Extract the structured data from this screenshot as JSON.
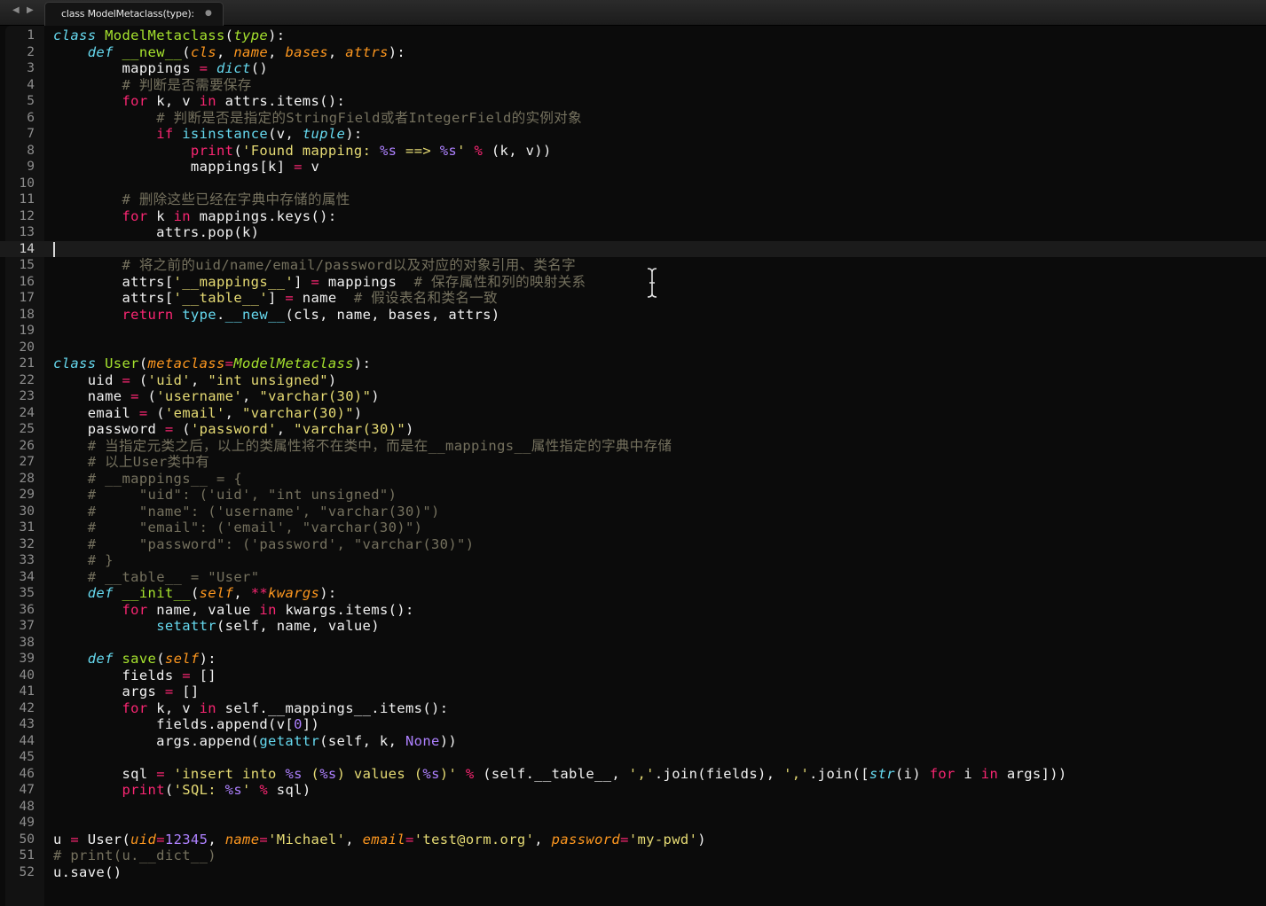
{
  "window": {
    "tab_title": "class ModelMetaclass(type):",
    "tab_modified_marker": "●",
    "nav_back": "◀",
    "nav_forward": "▶"
  },
  "colors": {
    "keyword": "#f92672",
    "storage": "#66d9ef",
    "class_name": "#a6e22e",
    "parameter": "#fd971f",
    "string": "#e6db74",
    "number": "#ae81ff",
    "comment": "#75715e",
    "text": "#f2f2f2"
  },
  "editor": {
    "active_line": 14,
    "lines": [
      {
        "n": "1",
        "tokens": [
          {
            "t": "class",
            "c": "storage",
            "i": 1
          },
          {
            "t": " "
          },
          {
            "t": "ModelMetaclass",
            "c": "class_name"
          },
          {
            "t": "("
          },
          {
            "t": "type",
            "c": "class_name",
            "i": 1
          },
          {
            "t": "):"
          }
        ]
      },
      {
        "n": "2",
        "tokens": [
          {
            "t": "    "
          },
          {
            "t": "def",
            "c": "storage",
            "i": 1
          },
          {
            "t": " "
          },
          {
            "t": "__new__",
            "c": "class_name"
          },
          {
            "t": "("
          },
          {
            "t": "cls",
            "c": "parameter",
            "i": 1
          },
          {
            "t": ", "
          },
          {
            "t": "name",
            "c": "parameter",
            "i": 1
          },
          {
            "t": ", "
          },
          {
            "t": "bases",
            "c": "parameter",
            "i": 1
          },
          {
            "t": ", "
          },
          {
            "t": "attrs",
            "c": "parameter",
            "i": 1
          },
          {
            "t": "):"
          }
        ]
      },
      {
        "n": "3",
        "tokens": [
          {
            "t": "        mappings "
          },
          {
            "t": "=",
            "c": "keyword"
          },
          {
            "t": " "
          },
          {
            "t": "dict",
            "c": "storage",
            "i": 1
          },
          {
            "t": "()"
          }
        ]
      },
      {
        "n": "4",
        "tokens": [
          {
            "t": "        "
          },
          {
            "t": "# 判断是否需要保存",
            "c": "comment"
          }
        ]
      },
      {
        "n": "5",
        "tokens": [
          {
            "t": "        "
          },
          {
            "t": "for",
            "c": "keyword"
          },
          {
            "t": " k, v "
          },
          {
            "t": "in",
            "c": "keyword"
          },
          {
            "t": " attrs.items():"
          }
        ]
      },
      {
        "n": "6",
        "tokens": [
          {
            "t": "            "
          },
          {
            "t": "# 判断是否是指定的StringField或者IntegerField的实例对象",
            "c": "comment"
          }
        ]
      },
      {
        "n": "7",
        "tokens": [
          {
            "t": "            "
          },
          {
            "t": "if",
            "c": "keyword"
          },
          {
            "t": " "
          },
          {
            "t": "isinstance",
            "c": "storage"
          },
          {
            "t": "(v, "
          },
          {
            "t": "tuple",
            "c": "storage",
            "i": 1
          },
          {
            "t": "):"
          }
        ]
      },
      {
        "n": "8",
        "tokens": [
          {
            "t": "                "
          },
          {
            "t": "print",
            "c": "keyword"
          },
          {
            "t": "("
          },
          {
            "t": "'Found mapping: ",
            "c": "string"
          },
          {
            "t": "%s",
            "c": "number"
          },
          {
            "t": " ==> ",
            "c": "string"
          },
          {
            "t": "%s",
            "c": "number"
          },
          {
            "t": "'",
            "c": "string"
          },
          {
            "t": " "
          },
          {
            "t": "%",
            "c": "keyword"
          },
          {
            "t": " (k, v))"
          }
        ]
      },
      {
        "n": "9",
        "tokens": [
          {
            "t": "                mappings[k] "
          },
          {
            "t": "=",
            "c": "keyword"
          },
          {
            "t": " v"
          }
        ]
      },
      {
        "n": "10",
        "tokens": []
      },
      {
        "n": "11",
        "tokens": [
          {
            "t": "        "
          },
          {
            "t": "# 删除这些已经在字典中存储的属性",
            "c": "comment"
          }
        ]
      },
      {
        "n": "12",
        "tokens": [
          {
            "t": "        "
          },
          {
            "t": "for",
            "c": "keyword"
          },
          {
            "t": " k "
          },
          {
            "t": "in",
            "c": "keyword"
          },
          {
            "t": " mappings.keys():"
          }
        ]
      },
      {
        "n": "13",
        "tokens": [
          {
            "t": "            attrs.pop(k)"
          }
        ]
      },
      {
        "n": "14",
        "tokens": []
      },
      {
        "n": "15",
        "tokens": [
          {
            "t": "        "
          },
          {
            "t": "# 将之前的uid/name/email/password以及对应的对象引用、类名字",
            "c": "comment"
          }
        ]
      },
      {
        "n": "16",
        "tokens": [
          {
            "t": "        attrs["
          },
          {
            "t": "'__mappings__'",
            "c": "string"
          },
          {
            "t": "] "
          },
          {
            "t": "=",
            "c": "keyword"
          },
          {
            "t": " mappings  "
          },
          {
            "t": "# 保存属性和列的映射关系",
            "c": "comment"
          }
        ]
      },
      {
        "n": "17",
        "tokens": [
          {
            "t": "        attrs["
          },
          {
            "t": "'__table__'",
            "c": "string"
          },
          {
            "t": "] "
          },
          {
            "t": "=",
            "c": "keyword"
          },
          {
            "t": " name  "
          },
          {
            "t": "# 假设表名和类名一致",
            "c": "comment"
          }
        ]
      },
      {
        "n": "18",
        "tokens": [
          {
            "t": "        "
          },
          {
            "t": "return",
            "c": "keyword"
          },
          {
            "t": " "
          },
          {
            "t": "type",
            "c": "storage"
          },
          {
            "t": "."
          },
          {
            "t": "__new__",
            "c": "storage"
          },
          {
            "t": "(cls, name, bases, attrs)"
          }
        ]
      },
      {
        "n": "19",
        "tokens": []
      },
      {
        "n": "20",
        "tokens": []
      },
      {
        "n": "21",
        "tokens": [
          {
            "t": "class",
            "c": "storage",
            "i": 1
          },
          {
            "t": " "
          },
          {
            "t": "User",
            "c": "class_name"
          },
          {
            "t": "("
          },
          {
            "t": "metaclass",
            "c": "parameter",
            "i": 1
          },
          {
            "t": "=",
            "c": "keyword"
          },
          {
            "t": "ModelMetaclass",
            "c": "class_name",
            "i": 1
          },
          {
            "t": "):"
          }
        ]
      },
      {
        "n": "22",
        "tokens": [
          {
            "t": "    uid "
          },
          {
            "t": "=",
            "c": "keyword"
          },
          {
            "t": " ("
          },
          {
            "t": "'uid'",
            "c": "string"
          },
          {
            "t": ", "
          },
          {
            "t": "\"int unsigned\"",
            "c": "string"
          },
          {
            "t": ")"
          }
        ]
      },
      {
        "n": "23",
        "tokens": [
          {
            "t": "    name "
          },
          {
            "t": "=",
            "c": "keyword"
          },
          {
            "t": " ("
          },
          {
            "t": "'username'",
            "c": "string"
          },
          {
            "t": ", "
          },
          {
            "t": "\"varchar(30)\"",
            "c": "string"
          },
          {
            "t": ")"
          }
        ]
      },
      {
        "n": "24",
        "tokens": [
          {
            "t": "    email "
          },
          {
            "t": "=",
            "c": "keyword"
          },
          {
            "t": " ("
          },
          {
            "t": "'email'",
            "c": "string"
          },
          {
            "t": ", "
          },
          {
            "t": "\"varchar(30)\"",
            "c": "string"
          },
          {
            "t": ")"
          }
        ]
      },
      {
        "n": "25",
        "tokens": [
          {
            "t": "    password "
          },
          {
            "t": "=",
            "c": "keyword"
          },
          {
            "t": " ("
          },
          {
            "t": "'password'",
            "c": "string"
          },
          {
            "t": ", "
          },
          {
            "t": "\"varchar(30)\"",
            "c": "string"
          },
          {
            "t": ")"
          }
        ]
      },
      {
        "n": "26",
        "tokens": [
          {
            "t": "    "
          },
          {
            "t": "# 当指定元类之后，以上的类属性将不在类中，而是在__mappings__属性指定的字典中存储",
            "c": "comment"
          }
        ]
      },
      {
        "n": "27",
        "tokens": [
          {
            "t": "    "
          },
          {
            "t": "# 以上User类中有",
            "c": "comment"
          }
        ]
      },
      {
        "n": "28",
        "tokens": [
          {
            "t": "    "
          },
          {
            "t": "# __mappings__ = {",
            "c": "comment"
          }
        ]
      },
      {
        "n": "29",
        "tokens": [
          {
            "t": "    "
          },
          {
            "t": "#     \"uid\": ('uid', \"int unsigned\")",
            "c": "comment"
          }
        ]
      },
      {
        "n": "30",
        "tokens": [
          {
            "t": "    "
          },
          {
            "t": "#     \"name\": ('username', \"varchar(30)\")",
            "c": "comment"
          }
        ]
      },
      {
        "n": "31",
        "tokens": [
          {
            "t": "    "
          },
          {
            "t": "#     \"email\": ('email', \"varchar(30)\")",
            "c": "comment"
          }
        ]
      },
      {
        "n": "32",
        "tokens": [
          {
            "t": "    "
          },
          {
            "t": "#     \"password\": ('password', \"varchar(30)\")",
            "c": "comment"
          }
        ]
      },
      {
        "n": "33",
        "tokens": [
          {
            "t": "    "
          },
          {
            "t": "# }",
            "c": "comment"
          }
        ]
      },
      {
        "n": "34",
        "tokens": [
          {
            "t": "    "
          },
          {
            "t": "# __table__ = \"User\"",
            "c": "comment"
          }
        ]
      },
      {
        "n": "35",
        "tokens": [
          {
            "t": "    "
          },
          {
            "t": "def",
            "c": "storage",
            "i": 1
          },
          {
            "t": " "
          },
          {
            "t": "__init__",
            "c": "class_name"
          },
          {
            "t": "("
          },
          {
            "t": "self",
            "c": "parameter",
            "i": 1
          },
          {
            "t": ", "
          },
          {
            "t": "**",
            "c": "keyword"
          },
          {
            "t": "kwargs",
            "c": "parameter",
            "i": 1
          },
          {
            "t": "):"
          }
        ]
      },
      {
        "n": "36",
        "tokens": [
          {
            "t": "        "
          },
          {
            "t": "for",
            "c": "keyword"
          },
          {
            "t": " name, value "
          },
          {
            "t": "in",
            "c": "keyword"
          },
          {
            "t": " kwargs.items():"
          }
        ]
      },
      {
        "n": "37",
        "tokens": [
          {
            "t": "            "
          },
          {
            "t": "setattr",
            "c": "storage"
          },
          {
            "t": "(self, name, value)"
          }
        ]
      },
      {
        "n": "38",
        "tokens": []
      },
      {
        "n": "39",
        "tokens": [
          {
            "t": "    "
          },
          {
            "t": "def",
            "c": "storage",
            "i": 1
          },
          {
            "t": " "
          },
          {
            "t": "save",
            "c": "class_name"
          },
          {
            "t": "("
          },
          {
            "t": "self",
            "c": "parameter",
            "i": 1
          },
          {
            "t": "):"
          }
        ]
      },
      {
        "n": "40",
        "tokens": [
          {
            "t": "        fields "
          },
          {
            "t": "=",
            "c": "keyword"
          },
          {
            "t": " []"
          }
        ]
      },
      {
        "n": "41",
        "tokens": [
          {
            "t": "        args "
          },
          {
            "t": "=",
            "c": "keyword"
          },
          {
            "t": " []"
          }
        ]
      },
      {
        "n": "42",
        "tokens": [
          {
            "t": "        "
          },
          {
            "t": "for",
            "c": "keyword"
          },
          {
            "t": " k, v "
          },
          {
            "t": "in",
            "c": "keyword"
          },
          {
            "t": " self.__mappings__.items():"
          }
        ]
      },
      {
        "n": "43",
        "tokens": [
          {
            "t": "            fields.append(v["
          },
          {
            "t": "0",
            "c": "number"
          },
          {
            "t": "])"
          }
        ]
      },
      {
        "n": "44",
        "tokens": [
          {
            "t": "            args.append("
          },
          {
            "t": "getattr",
            "c": "storage"
          },
          {
            "t": "(self, k, "
          },
          {
            "t": "None",
            "c": "number"
          },
          {
            "t": "))"
          }
        ]
      },
      {
        "n": "45",
        "tokens": []
      },
      {
        "n": "46",
        "tokens": [
          {
            "t": "        sql "
          },
          {
            "t": "=",
            "c": "keyword"
          },
          {
            "t": " "
          },
          {
            "t": "'insert into ",
            "c": "string"
          },
          {
            "t": "%s",
            "c": "number"
          },
          {
            "t": " (",
            "c": "string"
          },
          {
            "t": "%s",
            "c": "number"
          },
          {
            "t": ") values (",
            "c": "string"
          },
          {
            "t": "%s",
            "c": "number"
          },
          {
            "t": ")'",
            "c": "string"
          },
          {
            "t": " "
          },
          {
            "t": "%",
            "c": "keyword"
          },
          {
            "t": " (self.__table__, "
          },
          {
            "t": "','",
            "c": "string"
          },
          {
            "t": ".join(fields), "
          },
          {
            "t": "','",
            "c": "string"
          },
          {
            "t": ".join(["
          },
          {
            "t": "str",
            "c": "storage",
            "i": 1
          },
          {
            "t": "(i) "
          },
          {
            "t": "for",
            "c": "keyword"
          },
          {
            "t": " i "
          },
          {
            "t": "in",
            "c": "keyword"
          },
          {
            "t": " args]))"
          }
        ]
      },
      {
        "n": "47",
        "tokens": [
          {
            "t": "        "
          },
          {
            "t": "print",
            "c": "keyword"
          },
          {
            "t": "("
          },
          {
            "t": "'SQL: ",
            "c": "string"
          },
          {
            "t": "%s",
            "c": "number"
          },
          {
            "t": "'",
            "c": "string"
          },
          {
            "t": " "
          },
          {
            "t": "%",
            "c": "keyword"
          },
          {
            "t": " sql)"
          }
        ]
      },
      {
        "n": "48",
        "tokens": []
      },
      {
        "n": "49",
        "tokens": []
      },
      {
        "n": "50",
        "tokens": [
          {
            "t": "u "
          },
          {
            "t": "=",
            "c": "keyword"
          },
          {
            "t": " User("
          },
          {
            "t": "uid",
            "c": "parameter",
            "i": 1
          },
          {
            "t": "=",
            "c": "keyword"
          },
          {
            "t": "12345",
            "c": "number"
          },
          {
            "t": ", "
          },
          {
            "t": "name",
            "c": "parameter",
            "i": 1
          },
          {
            "t": "=",
            "c": "keyword"
          },
          {
            "t": "'Michael'",
            "c": "string"
          },
          {
            "t": ", "
          },
          {
            "t": "email",
            "c": "parameter",
            "i": 1
          },
          {
            "t": "=",
            "c": "keyword"
          },
          {
            "t": "'test@orm.org'",
            "c": "string"
          },
          {
            "t": ", "
          },
          {
            "t": "password",
            "c": "parameter",
            "i": 1
          },
          {
            "t": "=",
            "c": "keyword"
          },
          {
            "t": "'my-pwd'",
            "c": "string"
          },
          {
            "t": ")"
          }
        ]
      },
      {
        "n": "51",
        "tokens": [
          {
            "t": "# print(u.__dict__)",
            "c": "comment"
          }
        ]
      },
      {
        "n": "52",
        "tokens": [
          {
            "t": "u.save()"
          }
        ]
      }
    ]
  }
}
